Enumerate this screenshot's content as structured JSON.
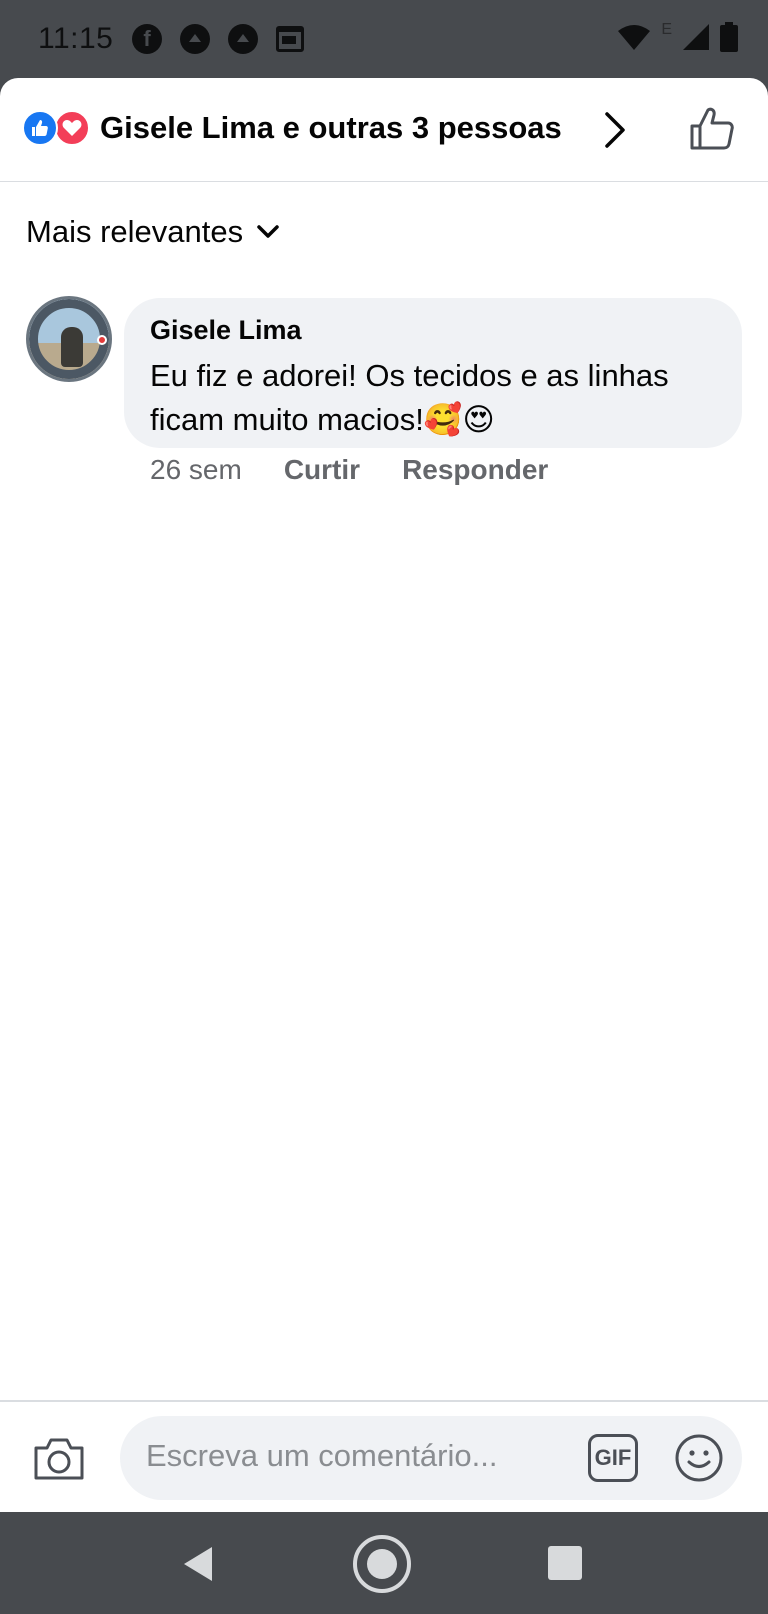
{
  "status_bar": {
    "time": "11:15",
    "network_label": "E"
  },
  "header": {
    "title": "Gisele Lima e outras 3 pessoas",
    "reactions": [
      "like-icon",
      "love-icon"
    ],
    "like_color": "#1877f2",
    "love_color": "#f33e58"
  },
  "sort": {
    "label": "Mais relevantes"
  },
  "comments": [
    {
      "author": "Gisele Lima",
      "text": "Eu fiz e adorei! Os tecidos e as linhas ficam muito macios!🥰😍",
      "time": "26 sem",
      "like_label": "Curtir",
      "reply_label": "Responder"
    }
  ],
  "composer": {
    "placeholder": "Escreva um comentário...",
    "gif_label": "GIF"
  }
}
